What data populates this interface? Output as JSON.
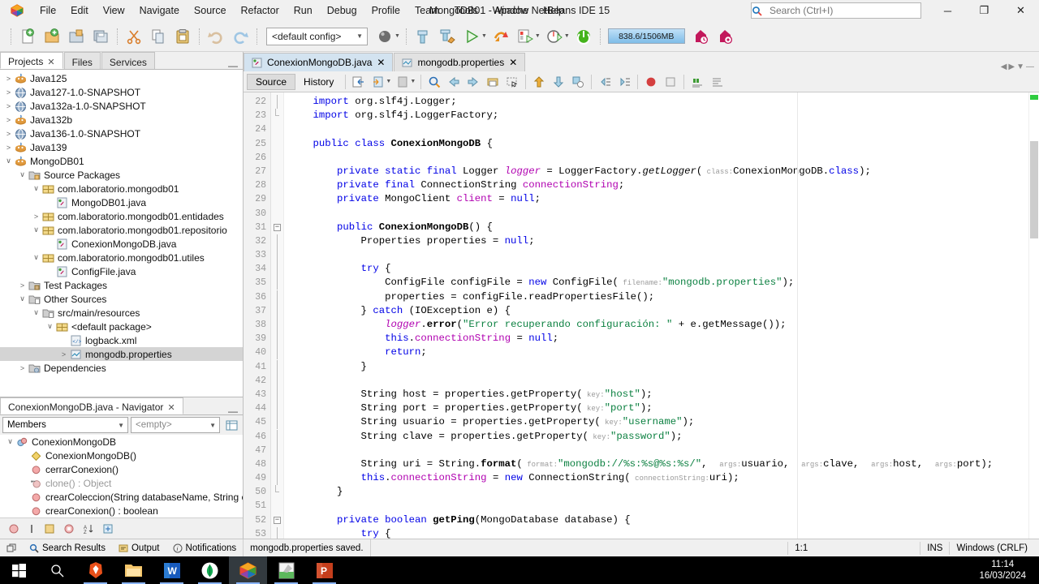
{
  "window": {
    "title": "MongoDB01 - Apache NetBeans IDE 15",
    "minimize_label": "─",
    "maximize_label": "❐",
    "close_label": "✕"
  },
  "menubar": {
    "items": [
      "File",
      "Edit",
      "View",
      "Navigate",
      "Source",
      "Refactor",
      "Run",
      "Debug",
      "Profile",
      "Team",
      "Tools",
      "Window",
      "Help"
    ]
  },
  "search": {
    "placeholder": "Search (Ctrl+I)",
    "value": ""
  },
  "toolbar": {
    "config_value": "<default config>",
    "memory_label": "838.6/1506MB",
    "buttons": [
      "new-file",
      "new-project",
      "open-project",
      "save-all",
      "cut",
      "copy",
      "paste",
      "undo",
      "redo",
      "profile-project",
      "build-project",
      "clean-build-project",
      "run-project",
      "debug-project",
      "profile-main-project",
      "team-update",
      "stop-build",
      "garbage-collect",
      "history",
      "notifications"
    ]
  },
  "left_panel": {
    "tabs": [
      {
        "label": "Projects",
        "closable": true,
        "active": true
      },
      {
        "label": "Files",
        "closable": false,
        "active": false
      },
      {
        "label": "Services",
        "closable": false,
        "active": false
      }
    ],
    "tree": [
      {
        "label": "Java125",
        "indent": 0,
        "twisty": "collapsed",
        "icon": "java-project"
      },
      {
        "label": "Java127-1.0-SNAPSHOT",
        "indent": 0,
        "twisty": "collapsed",
        "icon": "maven-project"
      },
      {
        "label": "Java132a-1.0-SNAPSHOT",
        "indent": 0,
        "twisty": "collapsed",
        "icon": "maven-project"
      },
      {
        "label": "Java132b",
        "indent": 0,
        "twisty": "collapsed",
        "icon": "java-project"
      },
      {
        "label": "Java136-1.0-SNAPSHOT",
        "indent": 0,
        "twisty": "collapsed",
        "icon": "maven-project"
      },
      {
        "label": "Java139",
        "indent": 0,
        "twisty": "collapsed",
        "icon": "java-project"
      },
      {
        "label": "MongoDB01",
        "indent": 0,
        "twisty": "expanded",
        "icon": "java-project"
      },
      {
        "label": "Source Packages",
        "indent": 1,
        "twisty": "expanded",
        "icon": "folder-src"
      },
      {
        "label": "com.laboratorio.mongodb01",
        "indent": 2,
        "twisty": "expanded",
        "icon": "package"
      },
      {
        "label": "MongoDB01.java",
        "indent": 3,
        "twisty": "none",
        "icon": "java-file"
      },
      {
        "label": "com.laboratorio.mongodb01.entidades",
        "indent": 2,
        "twisty": "collapsed",
        "icon": "package"
      },
      {
        "label": "com.laboratorio.mongodb01.repositorio",
        "indent": 2,
        "twisty": "expanded",
        "icon": "package"
      },
      {
        "label": "ConexionMongoDB.java",
        "indent": 3,
        "twisty": "none",
        "icon": "java-file"
      },
      {
        "label": "com.laboratorio.mongodb01.utiles",
        "indent": 2,
        "twisty": "expanded",
        "icon": "package"
      },
      {
        "label": "ConfigFile.java",
        "indent": 3,
        "twisty": "none",
        "icon": "java-file"
      },
      {
        "label": "Test Packages",
        "indent": 1,
        "twisty": "collapsed",
        "icon": "folder-test"
      },
      {
        "label": "Other Sources",
        "indent": 1,
        "twisty": "expanded",
        "icon": "folder-other"
      },
      {
        "label": "src/main/resources",
        "indent": 2,
        "twisty": "expanded",
        "icon": "folder-other"
      },
      {
        "label": "<default package>",
        "indent": 3,
        "twisty": "expanded",
        "icon": "package"
      },
      {
        "label": "logback.xml",
        "indent": 4,
        "twisty": "none",
        "icon": "xml-file"
      },
      {
        "label": "mongodb.properties",
        "indent": 4,
        "twisty": "collapsed",
        "icon": "properties-file",
        "selected": true
      },
      {
        "label": "Dependencies",
        "indent": 1,
        "twisty": "collapsed",
        "icon": "dependencies"
      }
    ]
  },
  "navigator": {
    "tab_label": "ConexionMongoDB.java - Navigator",
    "scope_value": "Members",
    "filter_value": "<empty>",
    "members": [
      {
        "label": "ConexionMongoDB",
        "indent": 0,
        "twisty": "expanded",
        "icon": "class",
        "dim": false
      },
      {
        "label": "ConexionMongoDB()",
        "indent": 1,
        "twisty": "none",
        "icon": "constructor",
        "dim": false
      },
      {
        "label": "cerrarConexion()",
        "indent": 1,
        "twisty": "none",
        "icon": "method-private",
        "dim": false
      },
      {
        "label": "clone() : Object",
        "indent": 1,
        "twisty": "none",
        "icon": "method-inherited",
        "dim": true
      },
      {
        "label": "crearColeccion(String databaseName, String c",
        "indent": 1,
        "twisty": "none",
        "icon": "method-private",
        "dim": false
      },
      {
        "label": "crearConexion() : boolean",
        "indent": 1,
        "twisty": "none",
        "icon": "method-private",
        "dim": false
      }
    ]
  },
  "editor": {
    "tabs": [
      {
        "label": "ConexionMongoDB.java",
        "icon": "java-file",
        "active": true
      },
      {
        "label": "mongodb.properties",
        "icon": "properties-file",
        "active": false
      }
    ],
    "view_buttons": [
      {
        "label": "Source",
        "active": true
      },
      {
        "label": "History",
        "active": false
      }
    ],
    "first_line": 22,
    "lines": [
      {
        "n": 22,
        "fold": "bar-top",
        "tokens": [
          {
            "t": "    ",
            "c": ""
          },
          {
            "t": "import",
            "c": "kw"
          },
          {
            "t": " org.slf4j.Logger;",
            "c": ""
          }
        ]
      },
      {
        "n": 23,
        "fold": "bar-end",
        "tokens": [
          {
            "t": "    ",
            "c": ""
          },
          {
            "t": "import",
            "c": "kw"
          },
          {
            "t": " org.slf4j.LoggerFactory;",
            "c": ""
          }
        ]
      },
      {
        "n": 24,
        "fold": "",
        "tokens": []
      },
      {
        "n": 25,
        "fold": "",
        "tokens": [
          {
            "t": "    ",
            "c": ""
          },
          {
            "t": "public",
            "c": "kw"
          },
          {
            "t": " ",
            "c": ""
          },
          {
            "t": "class",
            "c": "kw"
          },
          {
            "t": " ",
            "c": ""
          },
          {
            "t": "ConexionMongoDB",
            "c": "bd"
          },
          {
            "t": " {",
            "c": ""
          }
        ]
      },
      {
        "n": 26,
        "fold": "",
        "tokens": []
      },
      {
        "n": 27,
        "fold": "",
        "tokens": [
          {
            "t": "        ",
            "c": ""
          },
          {
            "t": "private",
            "c": "kw"
          },
          {
            "t": " ",
            "c": ""
          },
          {
            "t": "static",
            "c": "kw"
          },
          {
            "t": " ",
            "c": ""
          },
          {
            "t": "final",
            "c": "kw"
          },
          {
            "t": " Logger ",
            "c": ""
          },
          {
            "t": "logger",
            "c": "fld it"
          },
          {
            "t": " = LoggerFactory.",
            "c": ""
          },
          {
            "t": "getLogger",
            "c": "it"
          },
          {
            "t": "(",
            "c": ""
          },
          {
            "t": " class:",
            "c": "hint"
          },
          {
            "t": "ConexionMongoDB.",
            "c": ""
          },
          {
            "t": "class",
            "c": "kw"
          },
          {
            "t": ");",
            "c": ""
          }
        ]
      },
      {
        "n": 28,
        "fold": "",
        "tokens": [
          {
            "t": "        ",
            "c": ""
          },
          {
            "t": "private",
            "c": "kw"
          },
          {
            "t": " ",
            "c": ""
          },
          {
            "t": "final",
            "c": "kw"
          },
          {
            "t": " ConnectionString ",
            "c": ""
          },
          {
            "t": "connectionString",
            "c": "fld"
          },
          {
            "t": ";",
            "c": ""
          }
        ]
      },
      {
        "n": 29,
        "fold": "",
        "tokens": [
          {
            "t": "        ",
            "c": ""
          },
          {
            "t": "private",
            "c": "kw"
          },
          {
            "t": " MongoClient ",
            "c": ""
          },
          {
            "t": "client",
            "c": "fld"
          },
          {
            "t": " = ",
            "c": ""
          },
          {
            "t": "null",
            "c": "kw"
          },
          {
            "t": ";",
            "c": ""
          }
        ]
      },
      {
        "n": 30,
        "fold": "",
        "tokens": []
      },
      {
        "n": 31,
        "fold": "minus",
        "tokens": [
          {
            "t": "        ",
            "c": ""
          },
          {
            "t": "public",
            "c": "kw"
          },
          {
            "t": " ",
            "c": ""
          },
          {
            "t": "ConexionMongoDB",
            "c": "bd"
          },
          {
            "t": "() {",
            "c": ""
          }
        ]
      },
      {
        "n": 32,
        "fold": "bar",
        "tokens": [
          {
            "t": "            Properties properties = ",
            "c": ""
          },
          {
            "t": "null",
            "c": "kw"
          },
          {
            "t": ";",
            "c": ""
          }
        ]
      },
      {
        "n": 33,
        "fold": "bar",
        "tokens": []
      },
      {
        "n": 34,
        "fold": "bar",
        "tokens": [
          {
            "t": "            ",
            "c": ""
          },
          {
            "t": "try",
            "c": "kw"
          },
          {
            "t": " {",
            "c": ""
          }
        ]
      },
      {
        "n": 35,
        "fold": "bar",
        "tokens": [
          {
            "t": "                ConfigFile configFile = ",
            "c": ""
          },
          {
            "t": "new",
            "c": "kw"
          },
          {
            "t": " ConfigFile(",
            "c": ""
          },
          {
            "t": " filename:",
            "c": "hint"
          },
          {
            "t": "\"mongodb.properties\"",
            "c": "st"
          },
          {
            "t": ");",
            "c": ""
          }
        ]
      },
      {
        "n": 36,
        "fold": "bar",
        "tokens": [
          {
            "t": "                properties = configFile.readPropertiesFile();",
            "c": ""
          }
        ]
      },
      {
        "n": 37,
        "fold": "bar",
        "tokens": [
          {
            "t": "            } ",
            "c": ""
          },
          {
            "t": "catch",
            "c": "kw"
          },
          {
            "t": " (IOException e) {",
            "c": ""
          }
        ]
      },
      {
        "n": 38,
        "fold": "bar",
        "tokens": [
          {
            "t": "                ",
            "c": ""
          },
          {
            "t": "logger",
            "c": "fld it"
          },
          {
            "t": ".",
            "c": ""
          },
          {
            "t": "error",
            "c": "bd"
          },
          {
            "t": "(",
            "c": ""
          },
          {
            "t": "\"Error recuperando configuración: \"",
            "c": "st"
          },
          {
            "t": " + e.getMessage());",
            "c": ""
          }
        ]
      },
      {
        "n": 39,
        "fold": "bar",
        "tokens": [
          {
            "t": "                ",
            "c": ""
          },
          {
            "t": "this",
            "c": "kw"
          },
          {
            "t": ".",
            "c": ""
          },
          {
            "t": "connectionString",
            "c": "fld"
          },
          {
            "t": " = ",
            "c": ""
          },
          {
            "t": "null",
            "c": "kw"
          },
          {
            "t": ";",
            "c": ""
          }
        ]
      },
      {
        "n": 40,
        "fold": "bar",
        "tokens": [
          {
            "t": "                ",
            "c": ""
          },
          {
            "t": "return",
            "c": "kw"
          },
          {
            "t": ";",
            "c": ""
          }
        ]
      },
      {
        "n": 41,
        "fold": "bar",
        "tokens": [
          {
            "t": "            }",
            "c": ""
          }
        ]
      },
      {
        "n": 42,
        "fold": "bar",
        "tokens": []
      },
      {
        "n": 43,
        "fold": "bar",
        "tokens": [
          {
            "t": "            String host = properties.getProperty(",
            "c": ""
          },
          {
            "t": " key:",
            "c": "hint"
          },
          {
            "t": "\"host\"",
            "c": "st"
          },
          {
            "t": ");",
            "c": ""
          }
        ]
      },
      {
        "n": 44,
        "fold": "bar",
        "tokens": [
          {
            "t": "            String port = properties.getProperty(",
            "c": ""
          },
          {
            "t": " key:",
            "c": "hint"
          },
          {
            "t": "\"port\"",
            "c": "st"
          },
          {
            "t": ");",
            "c": ""
          }
        ]
      },
      {
        "n": 45,
        "fold": "bar",
        "tokens": [
          {
            "t": "            String usuario = properties.getProperty(",
            "c": ""
          },
          {
            "t": " key:",
            "c": "hint"
          },
          {
            "t": "\"username\"",
            "c": "st"
          },
          {
            "t": ");",
            "c": ""
          }
        ]
      },
      {
        "n": 46,
        "fold": "bar",
        "tokens": [
          {
            "t": "            String clave = properties.getProperty(",
            "c": ""
          },
          {
            "t": " key:",
            "c": "hint"
          },
          {
            "t": "\"password\"",
            "c": "st"
          },
          {
            "t": ");",
            "c": ""
          }
        ]
      },
      {
        "n": 47,
        "fold": "bar",
        "tokens": []
      },
      {
        "n": 48,
        "fold": "bar",
        "tokens": [
          {
            "t": "            String uri = String.",
            "c": ""
          },
          {
            "t": "format",
            "c": "bd"
          },
          {
            "t": "(",
            "c": ""
          },
          {
            "t": " format:",
            "c": "hint"
          },
          {
            "t": "\"mongodb://%s:%s@%s:%s/\"",
            "c": "st"
          },
          {
            "t": ",  ",
            "c": ""
          },
          {
            "t": "args:",
            "c": "hint"
          },
          {
            "t": "usuario,  ",
            "c": ""
          },
          {
            "t": "args:",
            "c": "hint"
          },
          {
            "t": "clave,  ",
            "c": ""
          },
          {
            "t": "args:",
            "c": "hint"
          },
          {
            "t": "host,  ",
            "c": ""
          },
          {
            "t": "args:",
            "c": "hint"
          },
          {
            "t": "port);",
            "c": ""
          }
        ]
      },
      {
        "n": 49,
        "fold": "bar",
        "tokens": [
          {
            "t": "            ",
            "c": ""
          },
          {
            "t": "this",
            "c": "kw"
          },
          {
            "t": ".",
            "c": ""
          },
          {
            "t": "connectionString",
            "c": "fld"
          },
          {
            "t": " = ",
            "c": ""
          },
          {
            "t": "new",
            "c": "kw"
          },
          {
            "t": " ConnectionString(",
            "c": ""
          },
          {
            "t": " connectionString:",
            "c": "hint"
          },
          {
            "t": "uri);",
            "c": ""
          }
        ]
      },
      {
        "n": 50,
        "fold": "bar-end",
        "tokens": [
          {
            "t": "        }",
            "c": ""
          }
        ]
      },
      {
        "n": 51,
        "fold": "",
        "tokens": []
      },
      {
        "n": 52,
        "fold": "minus",
        "tokens": [
          {
            "t": "        ",
            "c": ""
          },
          {
            "t": "private",
            "c": "kw"
          },
          {
            "t": " ",
            "c": ""
          },
          {
            "t": "boolean",
            "c": "kw"
          },
          {
            "t": " ",
            "c": ""
          },
          {
            "t": "getPing",
            "c": "bd"
          },
          {
            "t": "(MongoDatabase database) {",
            "c": ""
          }
        ]
      },
      {
        "n": 53,
        "fold": "bar",
        "tokens": [
          {
            "t": "            ",
            "c": ""
          },
          {
            "t": "try",
            "c": "kw"
          },
          {
            "t": " {",
            "c": ""
          }
        ]
      }
    ]
  },
  "statusbar": {
    "left_items": [
      {
        "label": "Search Results",
        "icon": "search-icon"
      },
      {
        "label": "Output",
        "icon": "output-icon"
      },
      {
        "label": "Notifications",
        "icon": "info-icon"
      }
    ],
    "message": "mongodb.properties saved.",
    "cursor_position": "1:1",
    "insert_mode": "INS",
    "line_ending": "Windows (CRLF)"
  },
  "taskbar": {
    "items": [
      {
        "name": "start-button",
        "icon": "windows-logo"
      },
      {
        "name": "search-button",
        "icon": "search-icon"
      },
      {
        "name": "brave-browser",
        "icon": "brave"
      },
      {
        "name": "file-explorer",
        "icon": "folder"
      },
      {
        "name": "word",
        "icon": "word"
      },
      {
        "name": "mongodb-compass",
        "icon": "mongodb"
      },
      {
        "name": "netbeans",
        "icon": "netbeans",
        "active": true
      },
      {
        "name": "notepad-editor",
        "icon": "notepad"
      },
      {
        "name": "powerpoint",
        "icon": "powerpoint"
      }
    ],
    "time": "11:14",
    "date": "16/03/2024"
  }
}
